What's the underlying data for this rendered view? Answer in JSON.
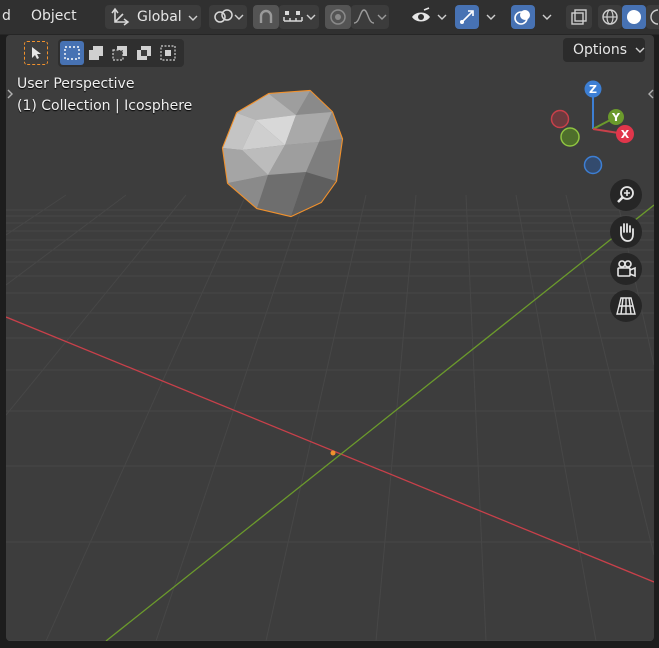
{
  "header": {
    "menu_partial": "d",
    "menu_object": "Object",
    "orientation": "Global"
  },
  "viewport": {
    "view_name": "User Perspective",
    "collection_label": "(1) Collection | Icosphere",
    "options_label": "Options"
  },
  "gizmo": {
    "x_label": "X",
    "y_label": "Y",
    "z_label": "Z"
  },
  "colors": {
    "x_axis": "#c8404a",
    "y_axis": "#6b9a2c",
    "z_axis": "#3d7fd4",
    "selection": "#f0912d",
    "active_button": "#4772b3",
    "viewport_bg": "#3d3d3d"
  }
}
